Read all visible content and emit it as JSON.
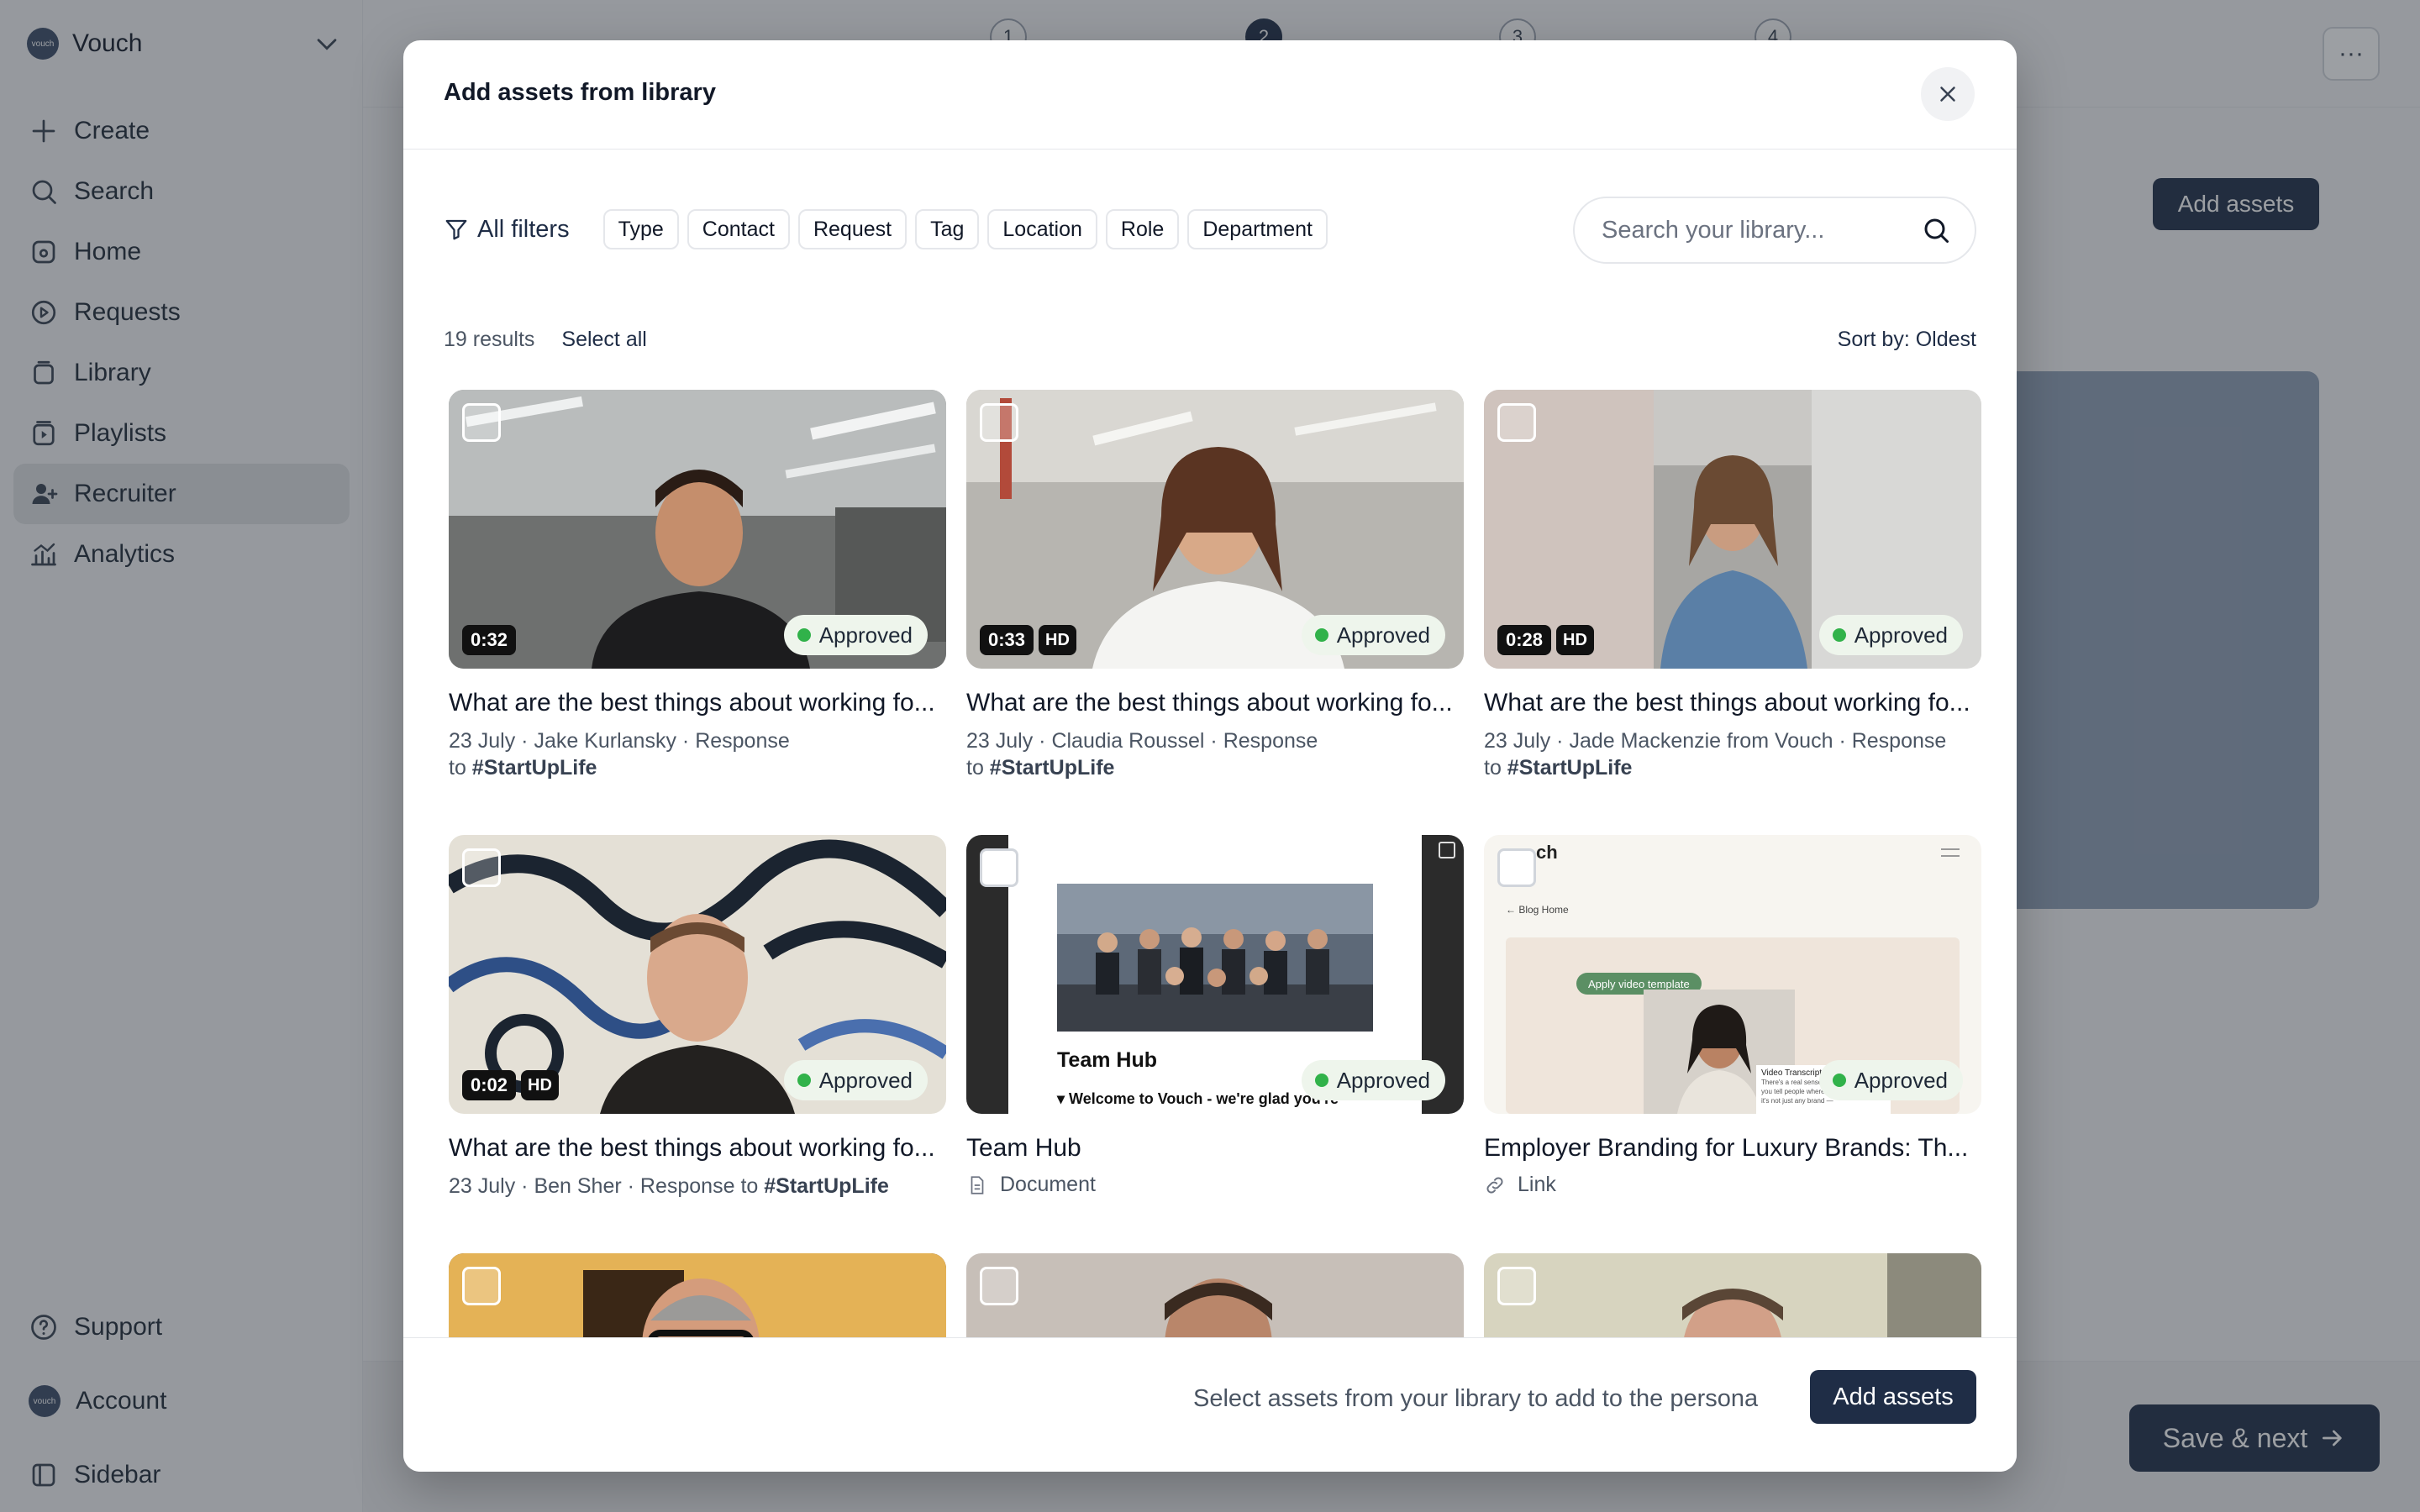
{
  "sidebar": {
    "brand": {
      "logo_text": "vouch",
      "name": "Vouch"
    },
    "items": [
      {
        "label": "Create",
        "icon": "plus-icon"
      },
      {
        "label": "Search",
        "icon": "search-icon"
      },
      {
        "label": "Home",
        "icon": "home-icon"
      },
      {
        "label": "Requests",
        "icon": "play-circle-icon"
      },
      {
        "label": "Library",
        "icon": "library-icon"
      },
      {
        "label": "Playlists",
        "icon": "playlist-icon"
      },
      {
        "label": "Recruiter",
        "icon": "user-add-icon",
        "active": true
      },
      {
        "label": "Analytics",
        "icon": "chart-icon"
      }
    ],
    "bottom": [
      {
        "label": "Support",
        "icon": "help-icon"
      },
      {
        "label": "Account",
        "icon": "account-avatar"
      },
      {
        "label": "Sidebar",
        "icon": "sidebar-toggle-icon"
      }
    ]
  },
  "steps": [
    "1",
    "2",
    "3",
    "4"
  ],
  "background": {
    "more_label": "···",
    "add_assets_label": "Add assets",
    "save_next_label": "Save & next"
  },
  "modal": {
    "title": "Add assets from library",
    "all_filters_label": "All filters",
    "filter_chips": [
      "Type",
      "Contact",
      "Request",
      "Tag",
      "Location",
      "Role",
      "Department"
    ],
    "search_placeholder": "Search your library...",
    "results_count": "19 results",
    "select_all_label": "Select all",
    "sort_label": "Sort by: Oldest",
    "footer_text": "Select assets from your library to add to the persona",
    "footer_button": "Add assets"
  },
  "cards": [
    {
      "title": "What are the best things about working fo...",
      "date": "23 July",
      "person": "Jake Kurlansky",
      "type": "Response",
      "request": "#StartUpLife",
      "duration": "0:32",
      "hd": "",
      "status": "Approved"
    },
    {
      "title": "What are the best things about working fo...",
      "date": "23 July",
      "person": "Claudia Roussel",
      "type": "Response",
      "request": "#StartUpLife",
      "duration": "0:33",
      "hd": "HD",
      "status": "Approved"
    },
    {
      "title": "What are the best things about working fo...",
      "date": "23 July",
      "person": "Jade Mackenzie from Vouch",
      "type": "Response",
      "request": "#StartUpLife",
      "duration": "0:28",
      "hd": "HD",
      "status": "Approved"
    },
    {
      "title": "What are the best things about working fo...",
      "date": "23 July",
      "person": "Ben Sher",
      "type": "Response",
      "request": "#StartUpLife",
      "duration": "0:02",
      "hd": "HD",
      "status": "Approved"
    },
    {
      "title": "Team Hub",
      "asset_type": "Document",
      "status": "Approved",
      "preview_heading": "Team Hub",
      "preview_sub": "▾ Welcome to Vouch - we're glad you're"
    },
    {
      "title": "Employer Branding for Luxury Brands: Th...",
      "asset_type": "Link",
      "status": "Approved",
      "preview_brand": "ch",
      "preview_back": "← Blog Home",
      "preview_tag": "Apply video template",
      "preview_caption": "Video Transcript",
      "preview_lines": [
        "There's a real sense",
        "you tell people where y",
        "it's not just any brand —"
      ]
    }
  ],
  "meta_joiners": {
    "sep": " · ",
    "to": "to "
  }
}
